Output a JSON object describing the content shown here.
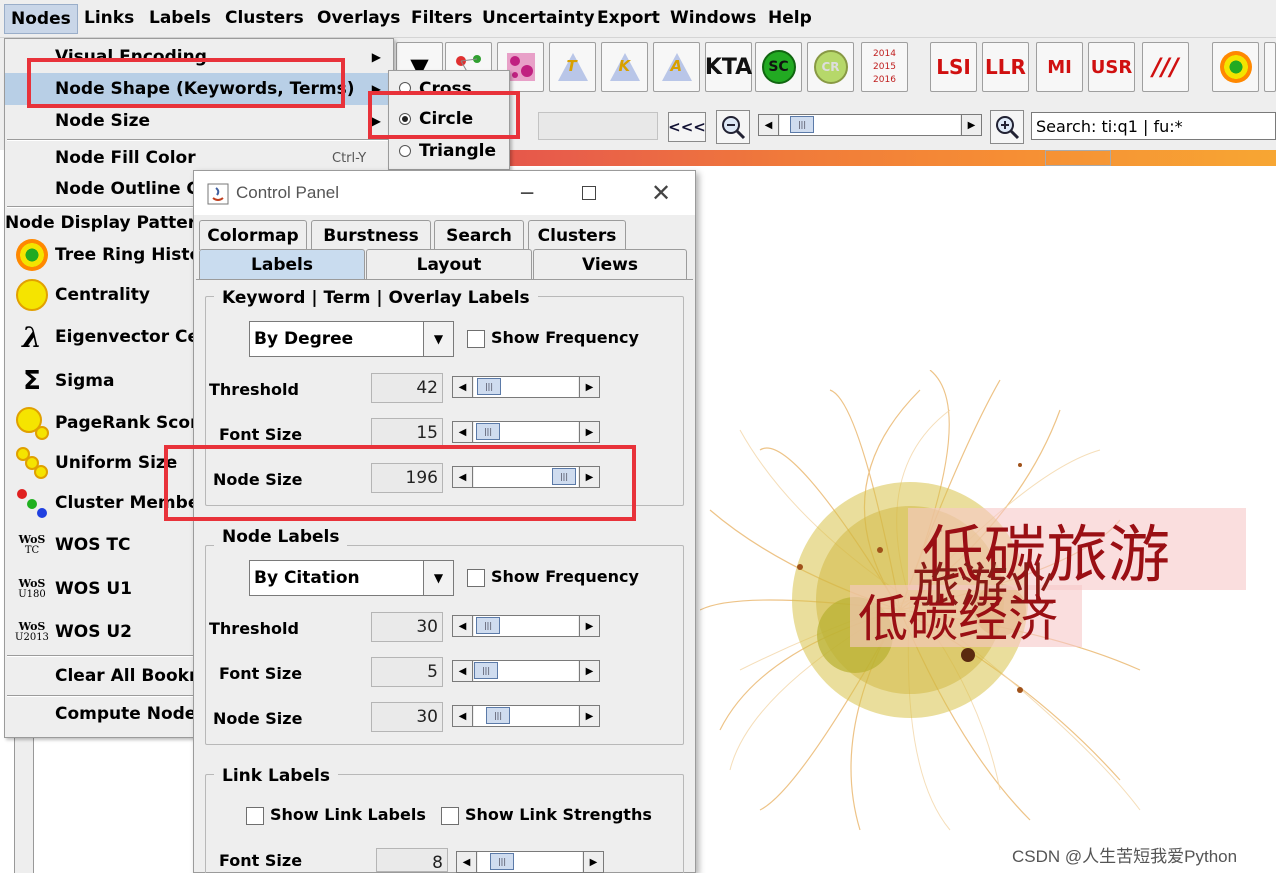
{
  "menubar": {
    "items": [
      "Nodes",
      "Links",
      "Labels",
      "Clusters",
      "Overlays",
      "Filters",
      "Uncertainty",
      "Export",
      "Windows",
      "Help"
    ]
  },
  "toolbar": {
    "kta": "KTA",
    "sc": "SC",
    "cr": "CR",
    "years": [
      "2014",
      "2015",
      "2016"
    ],
    "lsi": "LSI",
    "llr": "LLR",
    "mi": "MI",
    "usr": "USR",
    "slashes": "///",
    "tri_letters": [
      "T",
      "K",
      "A"
    ]
  },
  "row2": {
    "back_label": "<<<",
    "search_value": "Search: ti:q1 | fu:*"
  },
  "nodes_menu": {
    "visual_encoding": "Visual Encoding",
    "node_shape": "Node Shape (Keywords, Terms)",
    "node_size": "Node Size",
    "node_fill_color": "Node Fill Color",
    "node_fill_shortcut": "Ctrl-Y",
    "node_outline_color": "Node Outline Col",
    "display_patterns_title": "Node Display Patterns",
    "patterns": [
      "Tree Ring History",
      "Centrality",
      "Eigenvector Cen",
      "Sigma",
      "PageRank Score",
      "Uniform Size",
      "Cluster Members",
      "WOS TC",
      "WOS U1",
      "WOS U2"
    ],
    "wos_badges": [
      {
        "top": "WoS",
        "bottom": "TC"
      },
      {
        "top": "WoS",
        "bottom": "U180"
      },
      {
        "top": "WoS",
        "bottom": "U2013"
      }
    ],
    "clear_bookmarks": "Clear All Bookma",
    "compute_node": "Compute Node C"
  },
  "shape_submenu": {
    "options": [
      "Cross",
      "Circle",
      "Triangle"
    ],
    "selected": "Circle"
  },
  "control_panel": {
    "title": "Control Panel",
    "tabs_row1": [
      "Colormap",
      "Burstness",
      "Search",
      "Clusters"
    ],
    "tabs_row2": [
      "Labels",
      "Layout",
      "Views"
    ],
    "selected_tab": "Labels",
    "keyword_group": {
      "title": "Keyword | Term | Overlay Labels",
      "combo": "By Degree",
      "show_frequency": "Show Frequency",
      "threshold_label": "Threshold",
      "threshold": "42",
      "font_size_label": "Font Size",
      "font_size": "15",
      "node_size_label": "Node Size",
      "node_size": "196"
    },
    "node_labels_group": {
      "title": "Node Labels",
      "combo": "By Citation",
      "show_frequency": "Show Frequency",
      "threshold_label": "Threshold",
      "threshold": "30",
      "font_size_label": "Font Size",
      "font_size": "5",
      "node_size_label": "Node Size",
      "node_size": "30"
    },
    "link_labels_group": {
      "title": "Link Labels",
      "show_link_labels": "Show Link Labels",
      "show_link_strengths": "Show Link Strengths",
      "font_size_label": "Font Size",
      "font_size": "8"
    }
  },
  "visualization": {
    "labels": [
      "低碳旅游",
      "旅游业",
      "低碳经济"
    ]
  },
  "watermark": "CSDN @人生苦短我爱Python",
  "colors": {
    "highlight": "#e8323a",
    "selected_tab": "#c9dcef",
    "menu_highlight": "#b8cfe6"
  }
}
